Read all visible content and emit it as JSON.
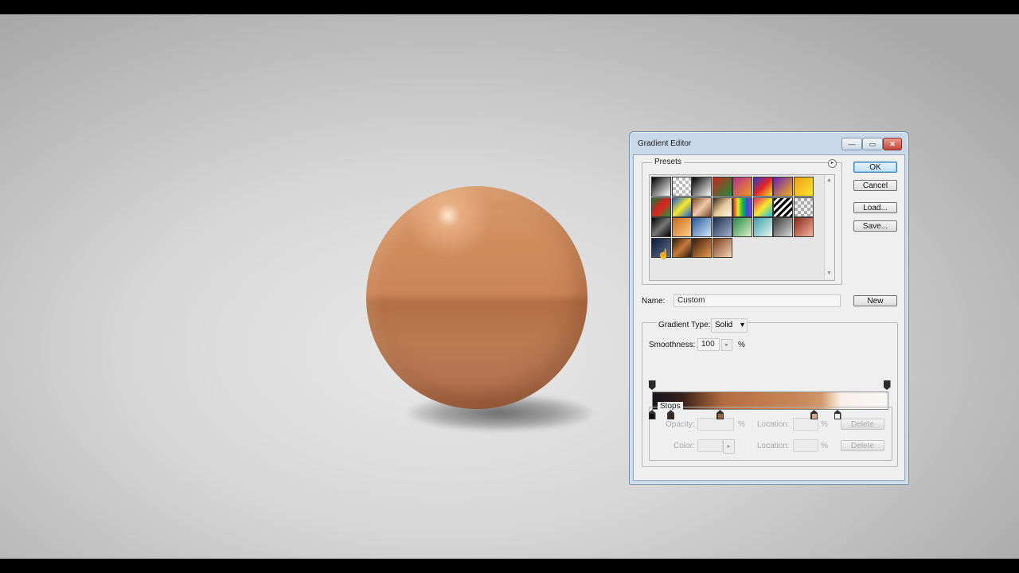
{
  "dialog": {
    "title": "Gradient Editor",
    "window_controls": {
      "minimize": "—",
      "maximize": "▭",
      "close": "✕"
    }
  },
  "buttons": {
    "ok": "OK",
    "cancel": "Cancel",
    "load": "Load...",
    "save": "Save...",
    "new": "New"
  },
  "presets": {
    "label": "Presets",
    "menu_icon": "play-circle-icon",
    "swatches": [
      "linear-gradient(135deg,#000,#fff)",
      "repeating-conic-gradient(#bbb 0 25%,#fff 0 50%) 0 0/8px 8px",
      "linear-gradient(135deg,#000,#fff)",
      "linear-gradient(135deg,#c7261f,#1f8f3a)",
      "linear-gradient(135deg,#b52d8f,#f39a1b)",
      "linear-gradient(135deg,#2d3bd1,#e2222a,#f6e71d)",
      "linear-gradient(135deg,#6a1fb3,#f2b21c)",
      "linear-gradient(135deg,#f09d1b,#f7e82a)",
      "linear-gradient(135deg,#0b7a32,#e41d1d,#1b9e3b)",
      "linear-gradient(135deg,#1c5ed6,#f7e82a,#1c5ed6)",
      "linear-gradient(135deg,#7a4a2a,#f2c8a7,#7a4a2a)",
      "linear-gradient(135deg,#3a2a1a,#e6c89a,#fff6e0)",
      "linear-gradient(90deg,#e41d1d,#f7e82a,#1bbf3b,#1c5ed6,#b52dcf)",
      "linear-gradient(135deg,#f21d6b,#f7e82a,#1bbfe8)",
      "repeating-linear-gradient(135deg,#000 0 3px,#fff 3px 6px)",
      "repeating-conic-gradient(#aaa 0 25%,#eee 0 50%) 0 0/8px 8px",
      "linear-gradient(135deg,#000,#777,#000)",
      "linear-gradient(135deg,#c86a1a,#ffd08a)",
      "linear-gradient(135deg,#2a5aa0,#d0e4f6)",
      "linear-gradient(135deg,#1e2b4a,#9fb3d0)",
      "linear-gradient(135deg,#2a8a4a,#d9f0c8)",
      "linear-gradient(135deg,#3aa0a8,#e9f6f4)",
      "linear-gradient(135deg,#3a3a3a,#d8d8d8)",
      "linear-gradient(135deg,#8a2a1a,#f4b39a)",
      "linear-gradient(135deg,#0c1a3a,#60718f)",
      "linear-gradient(135deg,#2a1a0a,#c87a3a,#2a1a0a)",
      "linear-gradient(135deg,#3a1a0a,#e89a4a)",
      "linear-gradient(135deg,#7a3a1a,#f6d7b8)"
    ],
    "scroll_up": "▲",
    "scroll_down": "▼"
  },
  "name_field": {
    "label": "Name:",
    "value": "Custom"
  },
  "gradient_type": {
    "label": "Gradient Type:",
    "value": "Solid",
    "arrow": "▾"
  },
  "smoothness": {
    "label": "Smoothness:",
    "value": "100",
    "unit": "%",
    "spinner": "▸"
  },
  "opacity_stops": [
    0.0,
    1.0
  ],
  "color_stops": [
    {
      "location": 0.0,
      "color": "#111111"
    },
    {
      "location": 0.08,
      "color": "#3a261c"
    },
    {
      "location": 0.29,
      "color": "#a5623c"
    },
    {
      "location": 0.69,
      "color": "#d8a988"
    },
    {
      "location": 0.79,
      "color": "#f4f4f4"
    }
  ],
  "stops": {
    "label": "Stops",
    "opacity_label": "Opacity:",
    "opacity_value": "",
    "opacity_unit": "%",
    "color_label": "Color:",
    "location_label_1": "Location:",
    "location_label_2": "Location:",
    "location_unit_1": "%",
    "location_unit_2": "%",
    "delete_1": "Delete",
    "delete_2": "Delete",
    "spin": "▸"
  },
  "colors": {
    "sphere_base": "#c98457",
    "dialog_frame": "#c9d8e8",
    "ok_highlight": "#bfe0f7"
  }
}
